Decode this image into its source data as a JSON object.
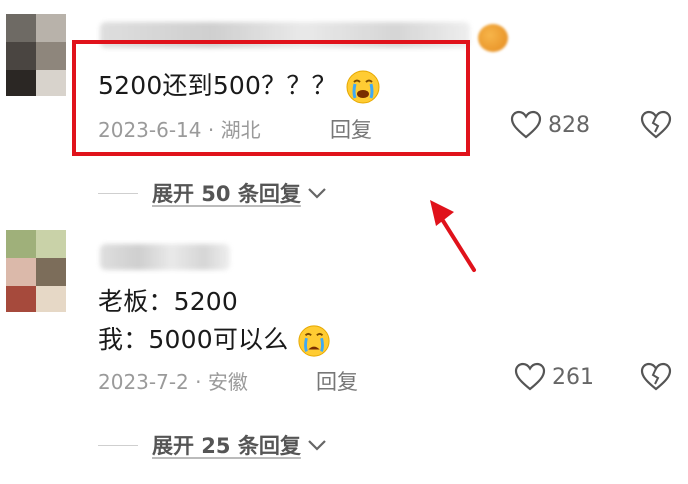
{
  "comments": [
    {
      "text": "5200还到500？？？",
      "date_location": "2023-6-14 · 湖北",
      "reply_label": "回复",
      "likes": "828",
      "expand_label": "展开 50 条回复",
      "emoji": "crying-face-icon"
    },
    {
      "line1": "老板：5200",
      "line2": "我：5000可以么",
      "date_location": "2023-7-2 · 安徽",
      "reply_label": "回复",
      "likes": "261",
      "expand_label": "展开 25 条回复",
      "emoji": "crying-face-icon"
    }
  ],
  "annotation": {
    "box_color": "#e0121b",
    "arrow_color": "#e0121b"
  }
}
